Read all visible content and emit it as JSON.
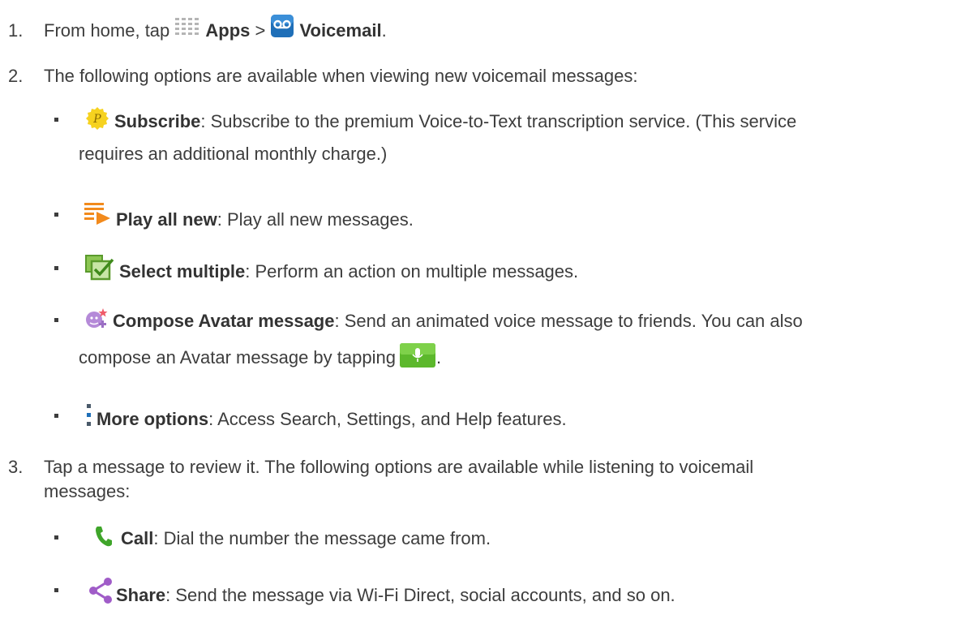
{
  "steps": [
    {
      "number": "1.",
      "text_before": "From home, tap ",
      "apps_label": "Apps",
      "separator": " > ",
      "voicemail_label": "Voicemail",
      "end": "."
    },
    {
      "number": "2.",
      "text": "The following options are available when viewing new voicemail messages:"
    },
    {
      "number": "3.",
      "text_line1": "Tap a message to review it. The following options are available while listening to voicemail",
      "text_line2": "messages:"
    }
  ],
  "new_options": [
    {
      "icon": "subscribe-icon",
      "label": "Subscribe",
      "desc_line1": ": Subscribe to the premium Voice-to-Text transcription service. (This service",
      "desc_line2": "requires an additional monthly charge.)"
    },
    {
      "icon": "play-all-icon",
      "label": "Play all new",
      "desc": ": Play all new messages."
    },
    {
      "icon": "select-multiple-icon",
      "label": "Select multiple",
      "desc": ": Perform an action on multiple messages."
    },
    {
      "icon": "avatar-message-icon",
      "label": "Compose Avatar message",
      "desc_line1": ": Send an animated voice message to friends. You can also",
      "desc_line2": "compose an Avatar message by tapping",
      "end": "."
    },
    {
      "icon": "more-options-icon",
      "label": "More options",
      "desc": ": Access Search, Settings, and Help features."
    }
  ],
  "listen_options": [
    {
      "icon": "call-icon",
      "label": "Call",
      "desc": ": Dial the number the message came from."
    },
    {
      "icon": "share-icon",
      "label": "Share",
      "desc": ": Send the message via Wi-Fi Direct, social accounts, and so on."
    }
  ],
  "colors": {
    "text": "#3d3d3d",
    "subscribe_yellow": "#f6d21f",
    "play_orange": "#f28a1c",
    "select_green": "#6ab33a",
    "avatar_purple": "#9b6fc4",
    "mic_green": "#5cb82c",
    "voicemail_blue": "#1f6fb8",
    "call_green": "#3fa52a",
    "share_purple": "#a05cc8"
  }
}
